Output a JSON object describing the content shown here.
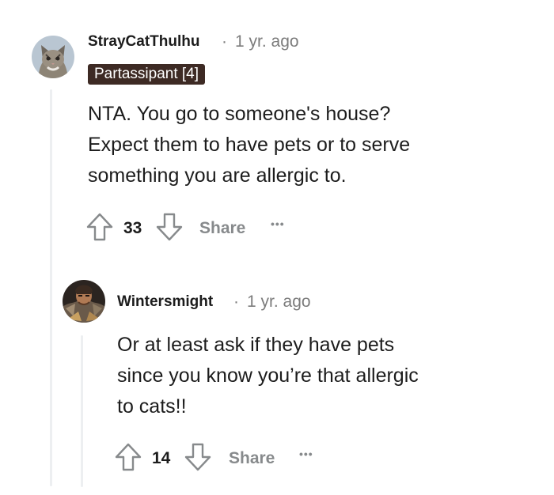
{
  "comments": [
    {
      "username": "StrayCatThulhu",
      "separator": "·",
      "time": "1 yr. ago",
      "flair": "Partassipant [4]",
      "body_lines": [
        "NTA. You go to someone's house?",
        "Expect them to have pets or to serve",
        "something you are allergic to."
      ],
      "votes": "33",
      "share_label": "Share",
      "more_label": "•••",
      "avatar_icon": "cat-avatar-icon"
    },
    {
      "username": "Wintersmight",
      "separator": "·",
      "time": "1 yr. ago",
      "body_lines": [
        "Or at least ask if they have pets",
        "since you know you’re that allergic",
        "to cats!!"
      ],
      "votes": "14",
      "share_label": "Share",
      "more_label": "•••",
      "avatar_icon": "warrior-avatar-icon"
    }
  ],
  "colors": {
    "flair_bg": "#3d2a24",
    "text": "#1c1c1c",
    "meta": "#7c7c7c",
    "action": "#878a8c",
    "thread_line": "#edeff1"
  }
}
